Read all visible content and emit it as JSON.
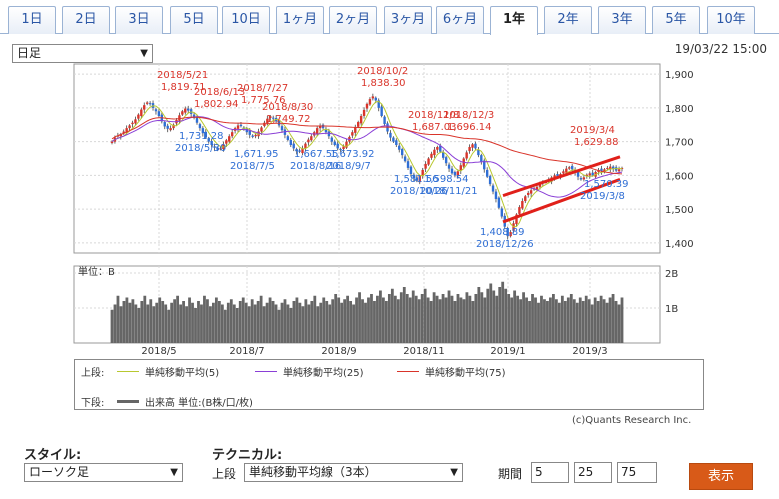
{
  "tabs": [
    "1日",
    "2日",
    "3日",
    "5日",
    "10日",
    "1ヶ月",
    "2ヶ月",
    "3ヶ月",
    "6ヶ月",
    "1年",
    "2年",
    "3年",
    "5年",
    "10年"
  ],
  "active_tab": "1年",
  "period_select": "日足",
  "timestamp": "19/03/22 15:00",
  "volume_unit": "単位：B",
  "chart_data": {
    "type": "candlestick",
    "price_axis": {
      "ticks": [
        "1,900",
        "1,800",
        "1,700",
        "1,600",
        "1,500",
        "1,400"
      ],
      "ylim": [
        1370,
        1930
      ]
    },
    "volume_axis": {
      "ticks": [
        "2B",
        "1B"
      ]
    },
    "x_labels": [
      "2018/5",
      "2018/7",
      "2018/9",
      "2018/11",
      "2019/1",
      "2019/3"
    ],
    "highs": [
      {
        "date": "2018/5/21",
        "value": "1,819.71"
      },
      {
        "date": "2018/6/13",
        "value": "1,802.94"
      },
      {
        "date": "2018/7/27",
        "value": "1,775.76"
      },
      {
        "date": "2018/8/30",
        "value": "1,749.72"
      },
      {
        "date": "2018/10/2",
        "value": "1,838.30"
      },
      {
        "date": "2018/11/8",
        "value": "1,687.03"
      },
      {
        "date": "2018/12/3",
        "value": "1,696.14"
      },
      {
        "date": "2019/3/4",
        "value": "1,629.88"
      }
    ],
    "lows": [
      {
        "date": "2018/5/30",
        "value": "1,731.28"
      },
      {
        "date": "2018/7/5",
        "value": "1,671.95"
      },
      {
        "date": "2018/8/16",
        "value": "1,667.55"
      },
      {
        "date": "2018/9/7",
        "value": "1,673.92"
      },
      {
        "date": "2018/10/26",
        "value": "1,581.56"
      },
      {
        "date": "2018/11/21",
        "value": "1,598.54"
      },
      {
        "date": "2018/12/26",
        "value": "1,408.89"
      },
      {
        "date": "2019/3/8",
        "value": "1,570.39"
      }
    ],
    "close_series": [
      1700,
      1712,
      1718,
      1722,
      1730,
      1740,
      1748,
      1756,
      1766,
      1780,
      1795,
      1808,
      1816,
      1812,
      1800,
      1790,
      1776,
      1760,
      1745,
      1738,
      1740,
      1750,
      1764,
      1778,
      1790,
      1798,
      1792,
      1782,
      1770,
      1756,
      1740,
      1725,
      1712,
      1700,
      1690,
      1682,
      1676,
      1680,
      1692,
      1704,
      1716,
      1728,
      1740,
      1748,
      1746,
      1738,
      1728,
      1720,
      1714,
      1720,
      1730,
      1742,
      1756,
      1768,
      1775,
      1770,
      1760,
      1748,
      1734,
      1720,
      1705,
      1690,
      1680,
      1672,
      1670,
      1680,
      1694,
      1706,
      1716,
      1728,
      1740,
      1746,
      1740,
      1728,
      1716,
      1700,
      1690,
      1680,
      1676,
      1686,
      1700,
      1714,
      1728,
      1742,
      1758,
      1776,
      1794,
      1812,
      1826,
      1834,
      1822,
      1800,
      1776,
      1752,
      1730,
      1712,
      1700,
      1690,
      1676,
      1660,
      1642,
      1622,
      1604,
      1592,
      1584,
      1598,
      1616,
      1634,
      1650,
      1664,
      1676,
      1684,
      1670,
      1652,
      1636,
      1620,
      1606,
      1600,
      1612,
      1630,
      1650,
      1668,
      1684,
      1692,
      1680,
      1660,
      1640,
      1618,
      1596,
      1574,
      1552,
      1530,
      1504,
      1478,
      1448,
      1420,
      1432,
      1458,
      1484,
      1506,
      1524,
      1538,
      1548,
      1556,
      1562,
      1566,
      1574,
      1582,
      1580,
      1586,
      1594,
      1600,
      1596,
      1604,
      1612,
      1620,
      1624,
      1618,
      1608,
      1596,
      1588,
      1594,
      1602,
      1606,
      1600,
      1610,
      1616,
      1612,
      1618,
      1622,
      1626,
      1620,
      1614,
      1618,
      1622
    ],
    "volume_series": [
      0.95,
      1.1,
      1.35,
      1.05,
      1.2,
      1.3,
      1.15,
      1.25,
      1.1,
      1.0,
      1.2,
      1.35,
      1.1,
      1.25,
      1.05,
      1.15,
      1.3,
      1.2,
      1.1,
      0.95,
      1.15,
      1.25,
      1.35,
      1.1,
      1.2,
      1.05,
      1.3,
      1.15,
      1.0,
      1.2,
      1.1,
      1.35,
      1.25,
      1.05,
      1.15,
      1.3,
      1.2,
      1.1,
      0.95,
      1.15,
      1.25,
      1.1,
      1.0,
      1.2,
      1.3,
      1.15,
      1.05,
      1.25,
      1.1,
      1.2,
      1.35,
      1.05,
      1.15,
      1.3,
      1.2,
      1.1,
      0.95,
      1.15,
      1.25,
      1.1,
      1.0,
      1.2,
      1.3,
      1.15,
      1.05,
      1.25,
      1.1,
      1.2,
      1.35,
      1.05,
      1.15,
      1.3,
      1.2,
      1.1,
      1.25,
      1.4,
      1.3,
      1.15,
      1.25,
      1.35,
      1.2,
      1.1,
      1.3,
      1.45,
      1.25,
      1.15,
      1.3,
      1.4,
      1.2,
      1.35,
      1.5,
      1.3,
      1.2,
      1.4,
      1.55,
      1.35,
      1.25,
      1.45,
      1.6,
      1.4,
      1.3,
      1.5,
      1.35,
      1.25,
      1.4,
      1.55,
      1.3,
      1.2,
      1.45,
      1.35,
      1.25,
      1.4,
      1.3,
      1.5,
      1.35,
      1.2,
      1.4,
      1.3,
      1.25,
      1.45,
      1.35,
      1.2,
      1.4,
      1.6,
      1.45,
      1.3,
      1.55,
      1.7,
      1.5,
      1.35,
      1.6,
      1.75,
      1.55,
      1.4,
      1.3,
      1.5,
      1.35,
      1.25,
      1.45,
      1.3,
      1.2,
      1.4,
      1.3,
      1.15,
      1.35,
      1.25,
      1.2,
      1.3,
      1.4,
      1.25,
      1.15,
      1.35,
      1.2,
      1.3,
      1.4,
      1.25,
      1.15,
      1.3,
      1.2,
      1.35,
      1.25,
      1.1,
      1.3,
      1.2,
      1.35,
      1.25,
      1.15,
      1.3,
      1.4,
      1.2,
      1.1,
      1.3
    ]
  },
  "legend": {
    "upper_label": "上段:",
    "lower_label": "下段:",
    "ma5": "単純移動平均(5)",
    "ma25": "単純移動平均(25)",
    "ma75": "単純移動平均(75)",
    "volume": "出来高 単位:(B株/口/枚)",
    "colors": {
      "ma5": "#b8c830",
      "ma25": "#8a3fd6",
      "ma75": "#d9342a",
      "volume": "#666666"
    }
  },
  "copyright": "(c)Quants Research Inc.",
  "controls": {
    "style_label": "スタイル:",
    "style_value": "ローソク足",
    "technical_label": "テクニカル:",
    "upper_row_label": "上段",
    "technical_value": "単純移動平均線（3本）",
    "period_label": "期間",
    "period_values": [
      "5",
      "25",
      "75"
    ],
    "show_button": "表示"
  }
}
